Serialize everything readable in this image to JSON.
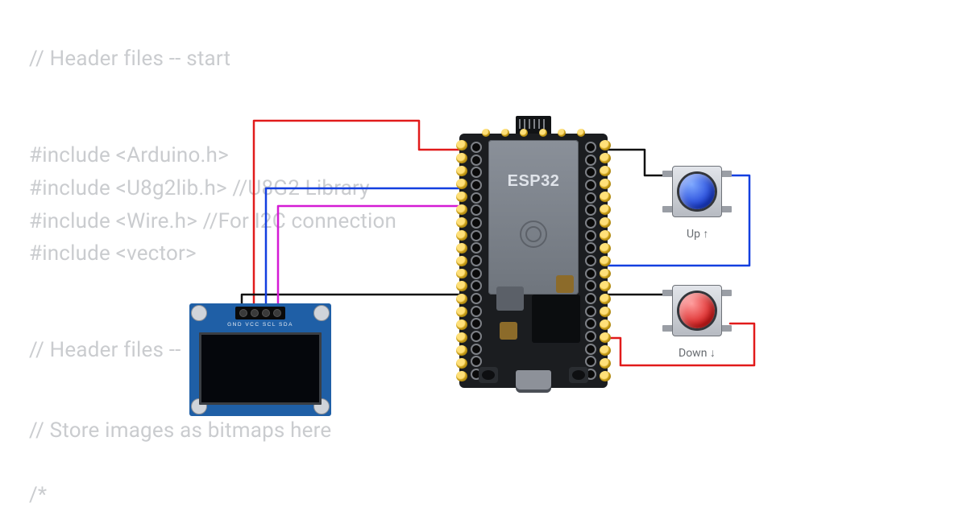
{
  "code": {
    "line1": "// Header files -- start",
    "line2": "#include <Arduino.h>",
    "line3": "#include <U8g2lib.h> //U8G2 Library",
    "line4": "#include <Wire.h> //For I2C connection",
    "line5": "#include <vector>",
    "line6": "// Header files --",
    "line7": "// Store images as bitmaps here",
    "line8": "/*"
  },
  "components": {
    "esp32_label": "ESP32",
    "oled_pins": "GND VCC SCL SDA",
    "button_up_label": "Up ↑",
    "button_down_label": "Down ↓"
  },
  "wires": {
    "oled_gnd_color": "#111111",
    "oled_vcc_color": "#e11b1b",
    "oled_scl_color": "#133fe0",
    "oled_sda_color": "#d41bd4",
    "btn_up_gnd_color": "#111111",
    "btn_up_sig_color": "#133fe0",
    "btn_down_gnd_color": "#111111",
    "btn_down_sig_color": "#e11b1b"
  }
}
